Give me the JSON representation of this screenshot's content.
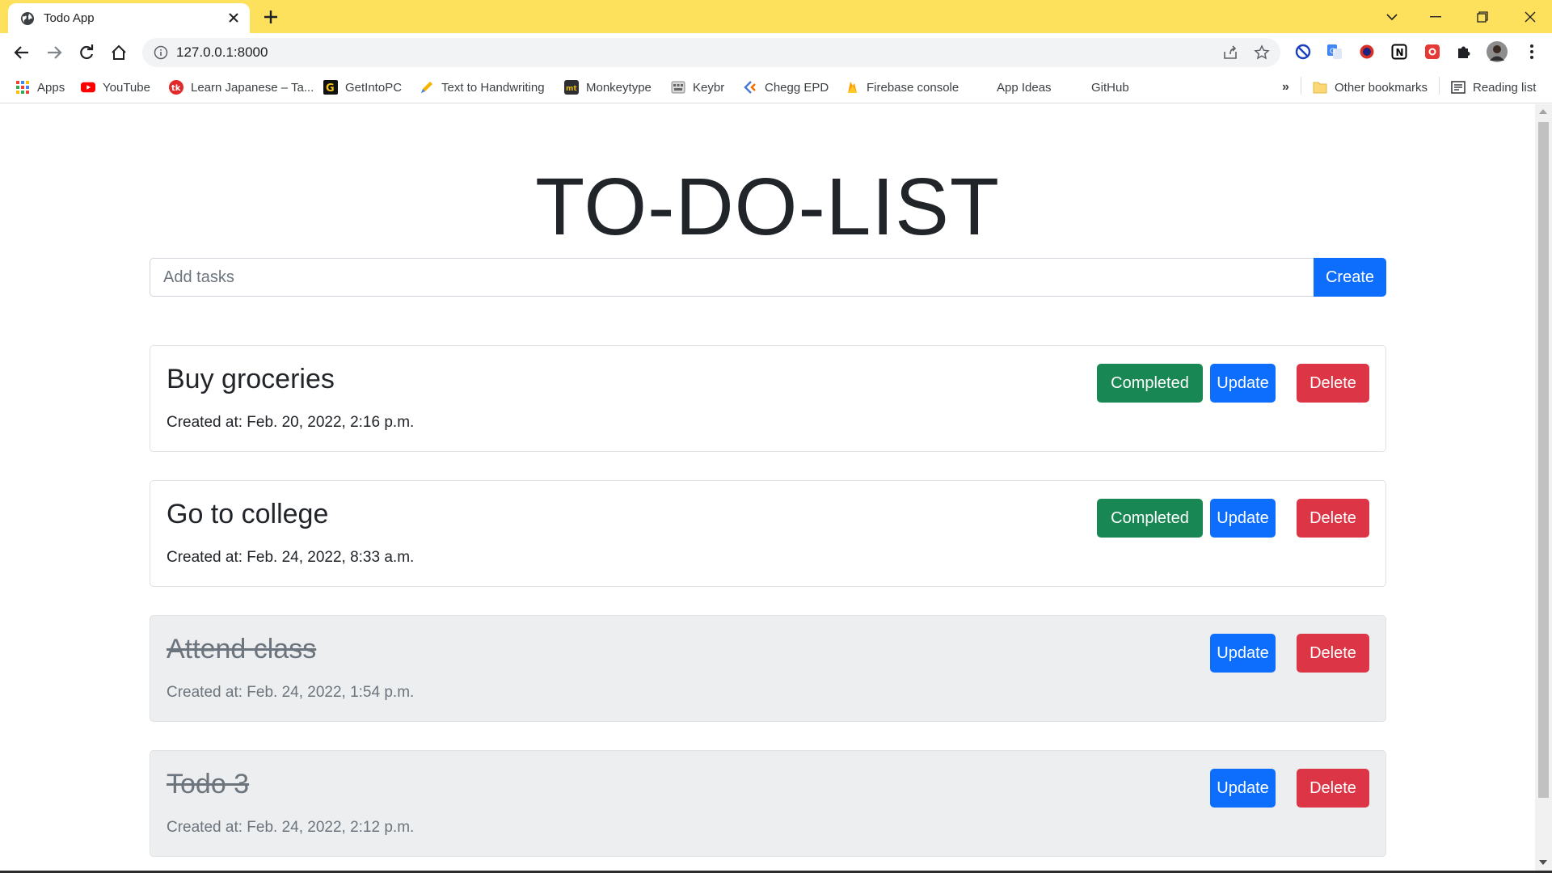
{
  "browser": {
    "tab_title": "Todo App",
    "url": "127.0.0.1:8000",
    "bookmarks": [
      {
        "label": "Apps",
        "icon": "apps-grid-icon"
      },
      {
        "label": "YouTube",
        "icon": "youtube-icon"
      },
      {
        "label": "Learn Japanese – Ta...",
        "icon": "tk-icon"
      },
      {
        "label": "GetIntoPC",
        "icon": "getintopc-icon"
      },
      {
        "label": "Text to Handwriting",
        "icon": "pen-icon"
      },
      {
        "label": "Monkeytype",
        "icon": "monkeytype-icon"
      },
      {
        "label": "Keybr",
        "icon": "keybr-icon"
      },
      {
        "label": "Chegg EPD",
        "icon": "chegg-icon"
      },
      {
        "label": "Firebase console",
        "icon": "firebase-icon"
      },
      {
        "label": "App Ideas",
        "icon": ""
      },
      {
        "label": "GitHub",
        "icon": ""
      }
    ],
    "overflow_label": "»",
    "other_bookmarks": "Other bookmarks",
    "reading_list": "Reading list"
  },
  "page": {
    "heading": "TO-DO-LIST",
    "input_placeholder": "Add tasks",
    "create_label": "Create"
  },
  "todos": [
    {
      "title": "Buy groceries",
      "created": "Created at: Feb. 20, 2022, 2:16 p.m.",
      "completed": false,
      "completed_label": "Completed",
      "update_label": "Update",
      "delete_label": "Delete"
    },
    {
      "title": "Go to college",
      "created": "Created at: Feb. 24, 2022, 8:33 a.m.",
      "completed": false,
      "completed_label": "Completed",
      "update_label": "Update",
      "delete_label": "Delete"
    },
    {
      "title": "Attend class",
      "created": "Created at: Feb. 24, 2022, 1:54 p.m.",
      "completed": true,
      "update_label": "Update",
      "delete_label": "Delete"
    },
    {
      "title": "Todo 3",
      "created": "Created at: Feb. 24, 2022, 2:12 p.m.",
      "completed": true,
      "update_label": "Update",
      "delete_label": "Delete"
    }
  ],
  "colors": {
    "tab_strip": "#fde05b",
    "primary": "#0d6efd",
    "success": "#198754",
    "danger": "#dc3545",
    "done_card": "#eceeef"
  }
}
